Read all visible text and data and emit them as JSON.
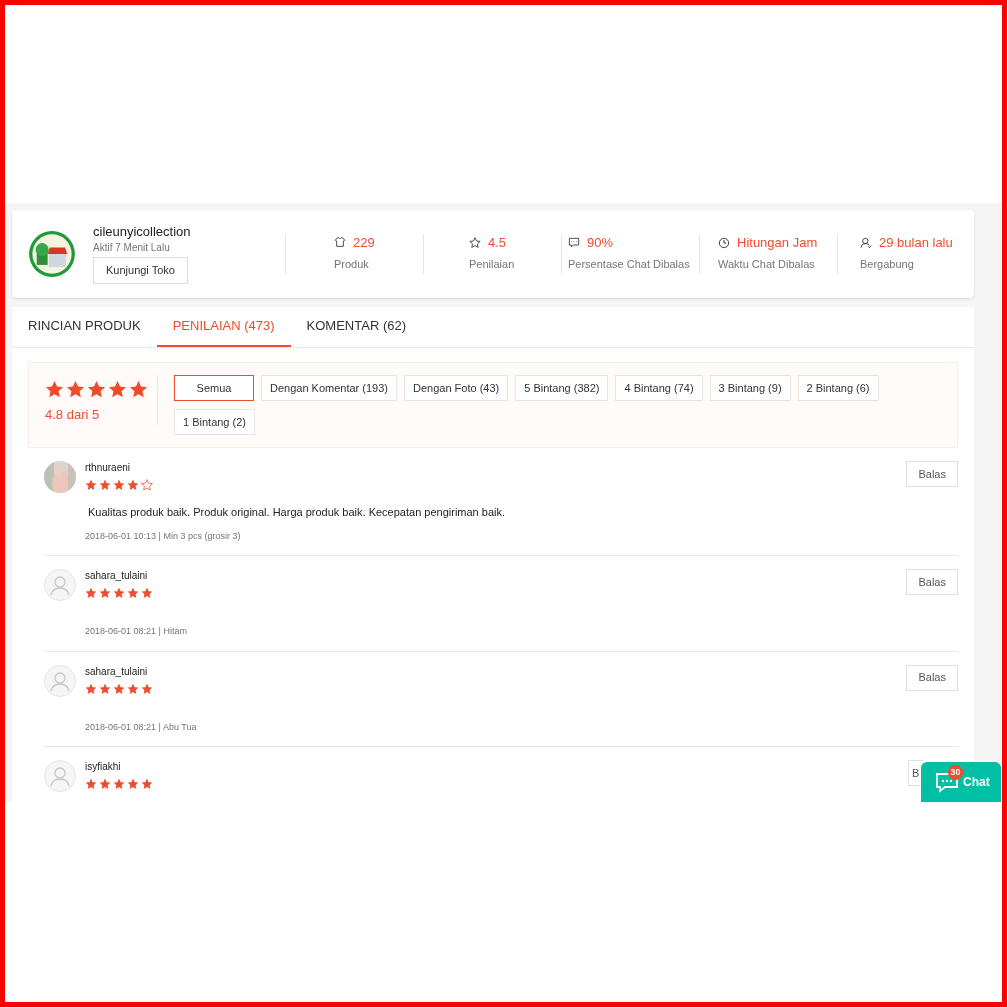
{
  "shop": {
    "name": "cileunyicollection",
    "status": "Aktif 7 Menit Lalu",
    "visit_button": "Kunjungi Toko",
    "stats": [
      {
        "kind": "shirt",
        "value": "229",
        "label": "Produk"
      },
      {
        "kind": "star",
        "value": "4.5",
        "label": "Penilaian"
      },
      {
        "kind": "chat",
        "value": "90%",
        "label": "Persentase Chat Dibalas"
      },
      {
        "kind": "clock",
        "value": "Hitungan Jam",
        "label": "Waktu Chat Dibalas"
      },
      {
        "kind": "user",
        "value": "29 bulan lalu",
        "label": "Bergabung"
      }
    ]
  },
  "tabs": [
    {
      "label": "RINCIAN PRODUK",
      "selected": false
    },
    {
      "label": "PENILAIAN (473)",
      "selected": true
    },
    {
      "label": "KOMENTAR (62)",
      "selected": false
    }
  ],
  "rating_summary": {
    "stars": 5,
    "score": "4.8 dari 5"
  },
  "filters": [
    {
      "label": "Semua",
      "selected": true
    },
    {
      "label": "Dengan Komentar (193)",
      "selected": false
    },
    {
      "label": "Dengan Foto (43)",
      "selected": false
    },
    {
      "label": "5 Bintang (382)",
      "selected": false
    },
    {
      "label": "4 Bintang (74)",
      "selected": false
    },
    {
      "label": "3 Bintang (9)",
      "selected": false
    },
    {
      "label": "2 Bintang (6)",
      "selected": false
    },
    {
      "label": "1 Bintang (2)",
      "selected": false
    }
  ],
  "reviews": [
    {
      "user": "rthnuraeni",
      "photo": true,
      "stars": 4,
      "comment": "Kualitas produk baik. Produk original. Harga produk baik. Kecepatan pengiriman baik.",
      "meta": "2018-06-01 10:13 | Min 3 pcs (grosir 3)",
      "reply_button": "Balas"
    },
    {
      "user": "sahara_tulaini",
      "photo": false,
      "stars": 5,
      "meta": "2018-06-01 08:21 | Hitam",
      "reply_button": "Balas"
    },
    {
      "user": "sahara_tulaini",
      "photo": false,
      "stars": 5,
      "meta": "2018-06-01 08:21 | Abu Tua",
      "reply_button": "Balas"
    },
    {
      "user": "isyfiakhi",
      "photo": false,
      "stars": 5,
      "reply_button": "B"
    }
  ],
  "chat_widget": {
    "label": "Chat",
    "badge": "30"
  }
}
